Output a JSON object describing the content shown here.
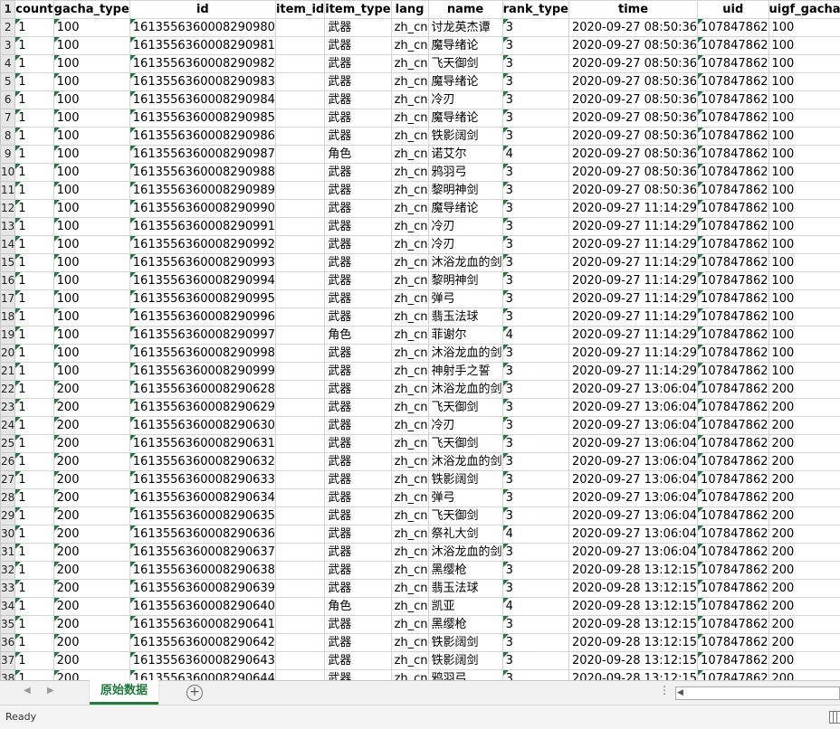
{
  "sheet": {
    "headers": [
      "count",
      "gacha_type",
      "id",
      "item_id",
      "item_type",
      "lang",
      "name",
      "rank_type",
      "time",
      "uid",
      "uigf_gacha_type"
    ],
    "rows": [
      {
        "num": "2",
        "cells": [
          "1",
          "100",
          "1613556360008290980",
          "",
          "武器",
          "zh_cn",
          "讨龙英杰谭",
          "3",
          "2020-09-27 08:50:36",
          "107847862",
          "100"
        ]
      },
      {
        "num": "3",
        "cells": [
          "1",
          "100",
          "1613556360008290981",
          "",
          "武器",
          "zh_cn",
          "魔导绪论",
          "3",
          "2020-09-27 08:50:36",
          "107847862",
          "100"
        ]
      },
      {
        "num": "4",
        "cells": [
          "1",
          "100",
          "1613556360008290982",
          "",
          "武器",
          "zh_cn",
          "飞天御剑",
          "3",
          "2020-09-27 08:50:36",
          "107847862",
          "100"
        ]
      },
      {
        "num": "5",
        "cells": [
          "1",
          "100",
          "1613556360008290983",
          "",
          "武器",
          "zh_cn",
          "魔导绪论",
          "3",
          "2020-09-27 08:50:36",
          "107847862",
          "100"
        ]
      },
      {
        "num": "6",
        "cells": [
          "1",
          "100",
          "1613556360008290984",
          "",
          "武器",
          "zh_cn",
          "冷刃",
          "3",
          "2020-09-27 08:50:36",
          "107847862",
          "100"
        ]
      },
      {
        "num": "7",
        "cells": [
          "1",
          "100",
          "1613556360008290985",
          "",
          "武器",
          "zh_cn",
          "魔导绪论",
          "3",
          "2020-09-27 08:50:36",
          "107847862",
          "100"
        ]
      },
      {
        "num": "8",
        "cells": [
          "1",
          "100",
          "1613556360008290986",
          "",
          "武器",
          "zh_cn",
          "铁影阔剑",
          "3",
          "2020-09-27 08:50:36",
          "107847862",
          "100"
        ]
      },
      {
        "num": "9",
        "cells": [
          "1",
          "100",
          "1613556360008290987",
          "",
          "角色",
          "zh_cn",
          "诺艾尔",
          "4",
          "2020-09-27 08:50:36",
          "107847862",
          "100"
        ]
      },
      {
        "num": "10",
        "cells": [
          "1",
          "100",
          "1613556360008290988",
          "",
          "武器",
          "zh_cn",
          "鸦羽弓",
          "3",
          "2020-09-27 08:50:36",
          "107847862",
          "100"
        ]
      },
      {
        "num": "11",
        "cells": [
          "1",
          "100",
          "1613556360008290989",
          "",
          "武器",
          "zh_cn",
          "黎明神剑",
          "3",
          "2020-09-27 08:50:36",
          "107847862",
          "100"
        ]
      },
      {
        "num": "12",
        "cells": [
          "1",
          "100",
          "1613556360008290990",
          "",
          "武器",
          "zh_cn",
          "魔导绪论",
          "3",
          "2020-09-27 11:14:29",
          "107847862",
          "100"
        ]
      },
      {
        "num": "13",
        "cells": [
          "1",
          "100",
          "1613556360008290991",
          "",
          "武器",
          "zh_cn",
          "冷刃",
          "3",
          "2020-09-27 11:14:29",
          "107847862",
          "100"
        ]
      },
      {
        "num": "14",
        "cells": [
          "1",
          "100",
          "1613556360008290992",
          "",
          "武器",
          "zh_cn",
          "冷刃",
          "3",
          "2020-09-27 11:14:29",
          "107847862",
          "100"
        ]
      },
      {
        "num": "15",
        "cells": [
          "1",
          "100",
          "1613556360008290993",
          "",
          "武器",
          "zh_cn",
          "沐浴龙血的剑",
          "3",
          "2020-09-27 11:14:29",
          "107847862",
          "100"
        ]
      },
      {
        "num": "16",
        "cells": [
          "1",
          "100",
          "1613556360008290994",
          "",
          "武器",
          "zh_cn",
          "黎明神剑",
          "3",
          "2020-09-27 11:14:29",
          "107847862",
          "100"
        ]
      },
      {
        "num": "17",
        "cells": [
          "1",
          "100",
          "1613556360008290995",
          "",
          "武器",
          "zh_cn",
          "弹弓",
          "3",
          "2020-09-27 11:14:29",
          "107847862",
          "100"
        ]
      },
      {
        "num": "18",
        "cells": [
          "1",
          "100",
          "1613556360008290996",
          "",
          "武器",
          "zh_cn",
          "翡玉法球",
          "3",
          "2020-09-27 11:14:29",
          "107847862",
          "100"
        ]
      },
      {
        "num": "19",
        "cells": [
          "1",
          "100",
          "1613556360008290997",
          "",
          "角色",
          "zh_cn",
          "菲谢尔",
          "4",
          "2020-09-27 11:14:29",
          "107847862",
          "100"
        ]
      },
      {
        "num": "20",
        "cells": [
          "1",
          "100",
          "1613556360008290998",
          "",
          "武器",
          "zh_cn",
          "沐浴龙血的剑",
          "3",
          "2020-09-27 11:14:29",
          "107847862",
          "100"
        ]
      },
      {
        "num": "21",
        "cells": [
          "1",
          "100",
          "1613556360008290999",
          "",
          "武器",
          "zh_cn",
          "神射手之誓",
          "3",
          "2020-09-27 11:14:29",
          "107847862",
          "100"
        ]
      },
      {
        "num": "22",
        "cells": [
          "1",
          "200",
          "1613556360008290628",
          "",
          "武器",
          "zh_cn",
          "沐浴龙血的剑",
          "3",
          "2020-09-27 13:06:04",
          "107847862",
          "200"
        ]
      },
      {
        "num": "23",
        "cells": [
          "1",
          "200",
          "1613556360008290629",
          "",
          "武器",
          "zh_cn",
          "飞天御剑",
          "3",
          "2020-09-27 13:06:04",
          "107847862",
          "200"
        ]
      },
      {
        "num": "24",
        "cells": [
          "1",
          "200",
          "1613556360008290630",
          "",
          "武器",
          "zh_cn",
          "冷刃",
          "3",
          "2020-09-27 13:06:04",
          "107847862",
          "200"
        ]
      },
      {
        "num": "25",
        "cells": [
          "1",
          "200",
          "1613556360008290631",
          "",
          "武器",
          "zh_cn",
          "飞天御剑",
          "3",
          "2020-09-27 13:06:04",
          "107847862",
          "200"
        ]
      },
      {
        "num": "26",
        "cells": [
          "1",
          "200",
          "1613556360008290632",
          "",
          "武器",
          "zh_cn",
          "沐浴龙血的剑",
          "3",
          "2020-09-27 13:06:04",
          "107847862",
          "200"
        ]
      },
      {
        "num": "27",
        "cells": [
          "1",
          "200",
          "1613556360008290633",
          "",
          "武器",
          "zh_cn",
          "铁影阔剑",
          "3",
          "2020-09-27 13:06:04",
          "107847862",
          "200"
        ]
      },
      {
        "num": "28",
        "cells": [
          "1",
          "200",
          "1613556360008290634",
          "",
          "武器",
          "zh_cn",
          "弹弓",
          "3",
          "2020-09-27 13:06:04",
          "107847862",
          "200"
        ]
      },
      {
        "num": "29",
        "cells": [
          "1",
          "200",
          "1613556360008290635",
          "",
          "武器",
          "zh_cn",
          "飞天御剑",
          "3",
          "2020-09-27 13:06:04",
          "107847862",
          "200"
        ]
      },
      {
        "num": "30",
        "cells": [
          "1",
          "200",
          "1613556360008290636",
          "",
          "武器",
          "zh_cn",
          "祭礼大剑",
          "4",
          "2020-09-27 13:06:04",
          "107847862",
          "200"
        ]
      },
      {
        "num": "31",
        "cells": [
          "1",
          "200",
          "1613556360008290637",
          "",
          "武器",
          "zh_cn",
          "沐浴龙血的剑",
          "3",
          "2020-09-27 13:06:04",
          "107847862",
          "200"
        ]
      },
      {
        "num": "32",
        "cells": [
          "1",
          "200",
          "1613556360008290638",
          "",
          "武器",
          "zh_cn",
          "黑缨枪",
          "3",
          "2020-09-28 13:12:15",
          "107847862",
          "200"
        ]
      },
      {
        "num": "33",
        "cells": [
          "1",
          "200",
          "1613556360008290639",
          "",
          "武器",
          "zh_cn",
          "翡玉法球",
          "3",
          "2020-09-28 13:12:15",
          "107847862",
          "200"
        ]
      },
      {
        "num": "34",
        "cells": [
          "1",
          "200",
          "1613556360008290640",
          "",
          "角色",
          "zh_cn",
          "凯亚",
          "4",
          "2020-09-28 13:12:15",
          "107847862",
          "200"
        ]
      },
      {
        "num": "35",
        "cells": [
          "1",
          "200",
          "1613556360008290641",
          "",
          "武器",
          "zh_cn",
          "黑缨枪",
          "3",
          "2020-09-28 13:12:15",
          "107847862",
          "200"
        ]
      },
      {
        "num": "36",
        "cells": [
          "1",
          "200",
          "1613556360008290642",
          "",
          "武器",
          "zh_cn",
          "铁影阔剑",
          "3",
          "2020-09-28 13:12:15",
          "107847862",
          "200"
        ]
      },
      {
        "num": "37",
        "cells": [
          "1",
          "200",
          "1613556360008290643",
          "",
          "武器",
          "zh_cn",
          "铁影阔剑",
          "3",
          "2020-09-28 13:12:15",
          "107847862",
          "200"
        ]
      },
      {
        "num": "38",
        "cells": [
          "1",
          "200",
          "1613556360008290644",
          "",
          "武器",
          "zh_cn",
          "鸦羽弓",
          "3",
          "2020-09-28 13:12:15",
          "107847862",
          "200"
        ]
      }
    ]
  },
  "tabs": {
    "active_label": "原始数据",
    "add_icon": "+",
    "dots": "⋮"
  },
  "icons": {
    "add": "plus-circle-icon",
    "prev": "chevron-left-icon",
    "next": "chevron-right-icon",
    "layout": "page-layout-icon"
  },
  "status": {
    "text": "Ready"
  },
  "colors": {
    "accent": "#1f7a3e",
    "flag": "#1e7a3c"
  }
}
